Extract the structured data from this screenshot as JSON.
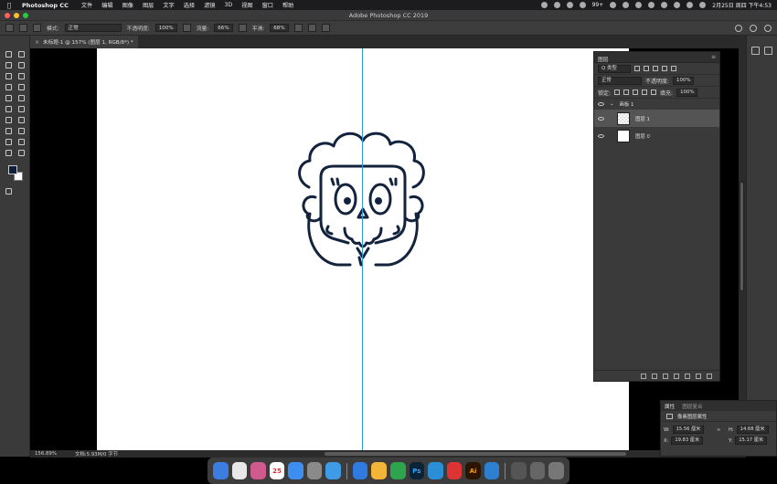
{
  "menubar": {
    "app_name": "Photoshop CC",
    "items": [
      "文件",
      "编辑",
      "图像",
      "图层",
      "文字",
      "选择",
      "滤镜",
      "3D",
      "视图",
      "窗口",
      "帮助"
    ],
    "badge": "99+",
    "clock": "2月25日 周四 下午4:53"
  },
  "window": {
    "title": "Adobe Photoshop CC 2019"
  },
  "options_bar": {
    "mode_label": "模式:",
    "mode_value": "正常",
    "opacity_label": "不透明度:",
    "opacity_value": "100%",
    "flow_label": "流量:",
    "flow_value": "66%",
    "smooth_label": "平滑:",
    "smooth_value": "68%"
  },
  "document": {
    "tab_title": "未标题-1 @ 157% (图层 1, RGB/8*) *",
    "zoom": "156.89%",
    "doc_size": "文档:5.93M/0 字节"
  },
  "layers_panel": {
    "title": "图层",
    "filter_label": "Q 类型",
    "blend_mode": "正常",
    "opacity_label": "不透明度:",
    "opacity_value": "100%",
    "lock_label": "锁定:",
    "fill_label": "填充:",
    "fill_value": "100%",
    "layers": [
      {
        "name": "画板 1",
        "type": "artboard"
      },
      {
        "name": "图层 1",
        "selected": true
      },
      {
        "name": "图层 0"
      }
    ]
  },
  "properties_panel": {
    "tab_properties": "属性",
    "tab_adjustments": "图层复合",
    "subtitle": "像素图层属性",
    "w_label": "W:",
    "w_value": "15.56 厘米",
    "h_label": "H:",
    "h_value": "14.68 厘米",
    "x_label": "X:",
    "x_value": "19.83 厘米",
    "y_label": "Y:",
    "y_value": "15.17 厘米"
  },
  "colors": {
    "foreground": "#0e1f3b",
    "background": "#ffffff",
    "guide": "#2f9bd7",
    "artwork_stroke": "#14233d"
  },
  "dock": {
    "apps": [
      "finder-icon",
      "chrome-icon",
      "launchpad-icon",
      "calendar-icon",
      "appstore-icon",
      "safari-icon",
      "sketch-icon",
      "wechat-icon",
      "photoshop-icon",
      "browser-icon",
      "xmind-icon",
      "illustrator-icon",
      "qq-browser-icon",
      "screenshot-icon",
      "trash-icon"
    ],
    "calendar_day": "25",
    "ps_label": "Ps",
    "ai_label": "Ai"
  }
}
